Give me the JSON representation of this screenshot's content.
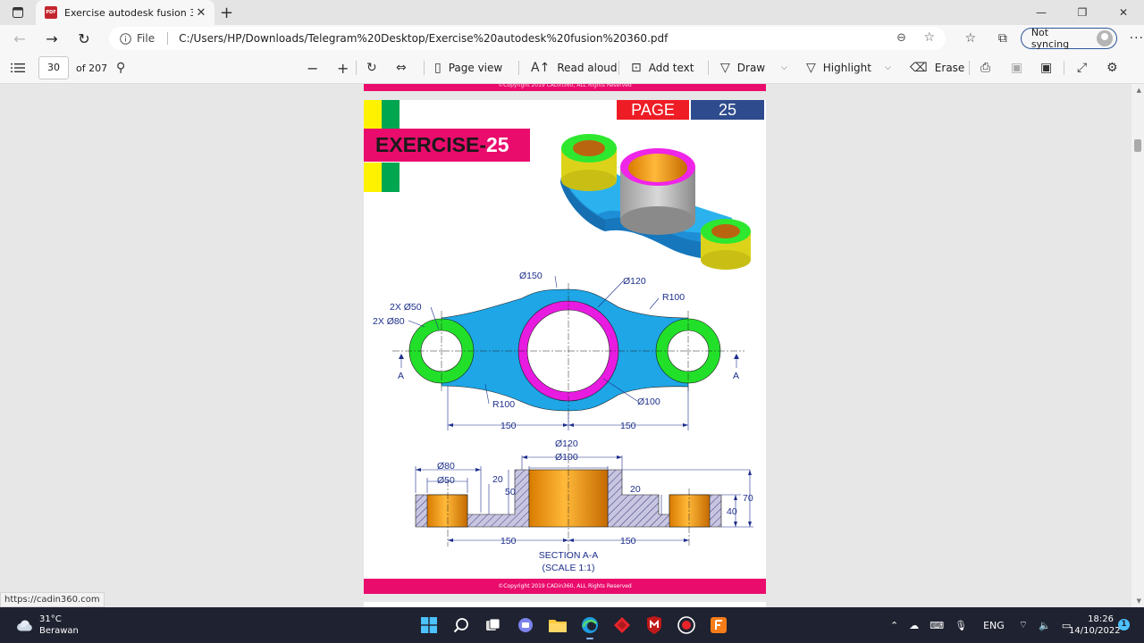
{
  "browser": {
    "tab_title": "Exercise autodesk fusion 360.pdf",
    "tab_badge": "PDF",
    "url_scheme_label": "File",
    "url": "C:/Users/HP/Downloads/Telegram%20Desktop/Exercise%20autodesk%20fusion%20360.pdf",
    "sync_label": "Not syncing"
  },
  "pdf_toolbar": {
    "current_page": "30",
    "total_pages": "of 207",
    "page_view": "Page view",
    "read_aloud": "Read aloud",
    "add_text": "Add text",
    "draw": "Draw",
    "highlight": "Highlight",
    "erase": "Erase"
  },
  "pdf_page": {
    "page_label": "PAGE",
    "page_number": "25",
    "exercise_word": "EXERCISE-",
    "exercise_number": "25",
    "copyright": "©Copyright 2019 CADin360, ALL Rights Reserved",
    "plan_labels": {
      "d150": "Ø150",
      "d120": "Ø120",
      "r100_top": "R100",
      "hole_d50": "2X Ø50",
      "hole_d80": "2X Ø80",
      "section_left": "A",
      "section_right": "A",
      "r100_bottom": "R100",
      "d100": "Ø100",
      "dist_left": "150",
      "dist_right": "150"
    },
    "section_labels": {
      "d120": "Ø120",
      "d100": "Ø100",
      "d80": "Ø80",
      "d50": "Ø50",
      "h20_left": "20",
      "h50": "50",
      "h20_right": "20",
      "h70": "70",
      "h40": "40",
      "dist_left": "150",
      "dist_right": "150",
      "caption_1": "SECTION A-A",
      "caption_2": "(SCALE 1:1)"
    }
  },
  "status_link": "https://cadin360.com",
  "taskbar": {
    "temperature": "31°C",
    "weather": "Berawan",
    "language": "ENG",
    "time": "18:26",
    "date": "14/10/2022",
    "notifications": "1"
  },
  "colors": {
    "brand_pink": "#ea0c6c",
    "page_red": "#ee1c25",
    "page_blue": "#2e4b8d",
    "part_blue": "#1ea6e6",
    "ring_green": "#22e02a",
    "ring_magenta": "#e81be0",
    "section_orange": "#f29a1a",
    "dimension_blue": "#1d2e8c"
  }
}
